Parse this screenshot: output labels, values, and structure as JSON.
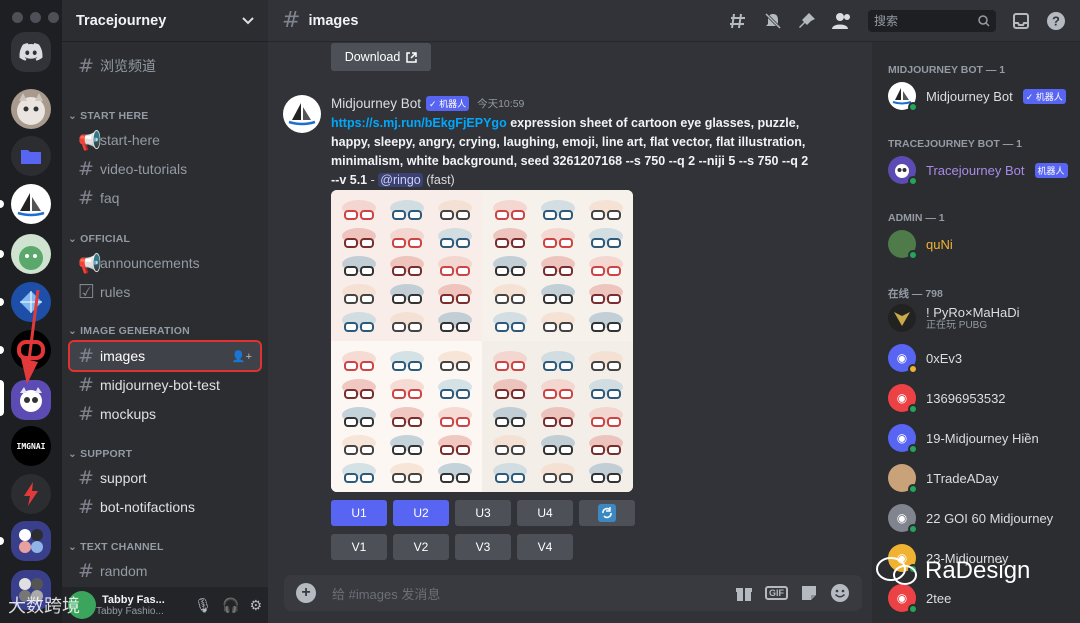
{
  "server_rail": {
    "servers": [
      "home",
      "cat",
      "folder",
      "midjourney",
      "green-bot",
      "crystal",
      "o-logo",
      "tracejourney",
      "imgnai",
      "bolt",
      "group1",
      "group2"
    ]
  },
  "sidebar": {
    "guild_name": "Tracejourney",
    "browse_label": "浏览频道",
    "categories": [
      {
        "name": "START HERE",
        "channels": [
          "start-here",
          "video-tutorials",
          "faq"
        ]
      },
      {
        "name": "OFFICIAL",
        "channels": [
          "announcements",
          "rules"
        ]
      },
      {
        "name": "IMAGE GENERATION",
        "channels": [
          "images",
          "midjourney-bot-test",
          "mockups"
        ]
      },
      {
        "name": "SUPPORT",
        "channels": [
          "support",
          "bot-notifactions"
        ]
      },
      {
        "name": "TEXT CHANNEL",
        "channels": [
          "random"
        ]
      }
    ],
    "user": {
      "name": "Tabby Fas...",
      "sub": "Tabby Fashio..."
    }
  },
  "topbar": {
    "channel": "images",
    "search_placeholder": "搜索"
  },
  "message": {
    "download_label": "Download",
    "author": "Midjourney Bot",
    "badge": "✓ 机器人",
    "time": "今天10:59",
    "link": "https://s.mj.run/bEkgFjEPYgo",
    "prompt": "expression sheet of cartoon eye glasses, puzzle, happy, sleepy, angry, crying, laughing, emoji, line art, flat vector, flat illustration, minimalism, white background, seed 3261207168 --s 750 --q 2 --niji 5 --s 750 --q 2 --v 5.1",
    "separator": " - ",
    "mention": "@ringo",
    "mode": "(fast)",
    "buttons_row1": [
      "U1",
      "U2",
      "U3",
      "U4"
    ],
    "buttons_row2": [
      "V1",
      "V2",
      "V3",
      "V4"
    ]
  },
  "composer": {
    "placeholder": "给 #images 发消息",
    "gif": "GIF"
  },
  "members": {
    "groups": [
      {
        "title": "MIDJOURNEY BOT — 1",
        "members": [
          {
            "name": "Midjourney Bot",
            "badge": "✓ 机器人"
          }
        ]
      },
      {
        "title": "TRACEJOURNEY BOT — 1",
        "members": [
          {
            "name": "Tracejourney Bot",
            "badge": "机器人"
          }
        ]
      },
      {
        "title": "ADMIN — 1",
        "members": [
          {
            "name": "quNi"
          }
        ]
      },
      {
        "title": "在线 — 798",
        "members": [
          {
            "name": "! PyRo×MaHaDi",
            "sub": "正在玩 PUBG"
          },
          {
            "name": "0xEv3"
          },
          {
            "name": "13696953532"
          },
          {
            "name": "19-Midjourney Hiền"
          },
          {
            "name": "1TradeADay"
          },
          {
            "name": "22 GOI 60 Midjourney"
          },
          {
            "name": "23-Midjourney"
          },
          {
            "name": "2tee"
          }
        ]
      }
    ]
  },
  "watermarks": {
    "right": "RaDesign",
    "left": "大数跨境"
  },
  "colors": {
    "accent": "#5865f2",
    "link": "#00a8fc",
    "highlight": "#e0322e",
    "online": "#23a55a"
  }
}
